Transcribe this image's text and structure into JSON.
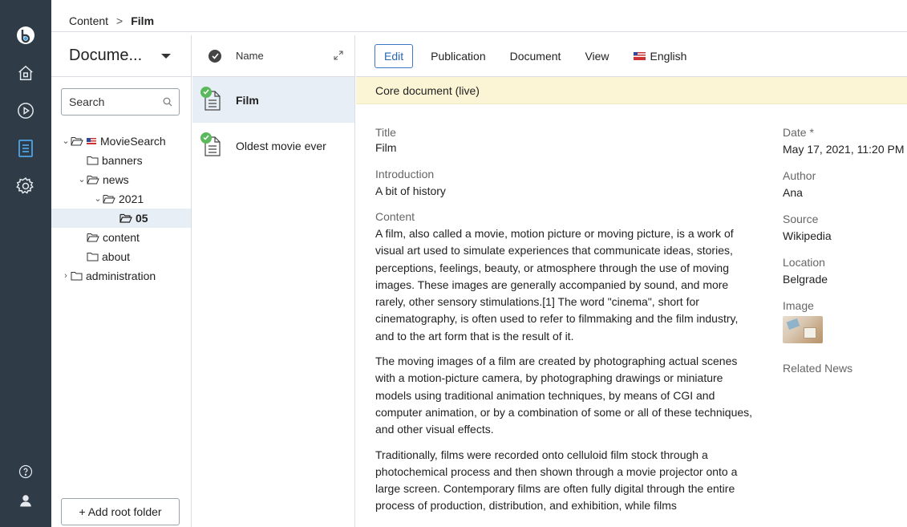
{
  "breadcrumb": {
    "root": "Content",
    "separator": ">",
    "current": "Film"
  },
  "tree_panel": {
    "title": "Docume...",
    "search_placeholder": "Search",
    "items": [
      {
        "label": "MovieSearch",
        "expanded": true,
        "flag": true
      },
      {
        "label": "banners"
      },
      {
        "label": "news",
        "expanded": true
      },
      {
        "label": "2021",
        "expanded": true
      },
      {
        "label": "05",
        "selected": true
      },
      {
        "label": "content"
      },
      {
        "label": "about"
      },
      {
        "label": "administration",
        "expanded": false
      }
    ],
    "add_root": "+ Add root folder"
  },
  "list_panel": {
    "column": "Name",
    "items": [
      {
        "name": "Film",
        "selected": true
      },
      {
        "name": "Oldest movie ever"
      }
    ]
  },
  "tabs": [
    "Edit",
    "Publication",
    "Document",
    "View",
    "English"
  ],
  "banner": "Core document (live)",
  "fields": {
    "title_label": "Title",
    "title": "Film",
    "intro_label": "Introduction",
    "intro": "A bit of history",
    "content_label": "Content",
    "paragraphs": [
      "A film, also called a movie, motion picture or moving picture, is a work of visual art used to simulate experiences that communicate ideas, stories, perceptions, feelings, beauty, or atmosphere through the use of moving images. These images are generally accompanied by sound, and more rarely, other sensory stimulations.[1] The word \"cinema\", short for cinematography, is often used to refer to filmmaking and the film industry, and to the art form that is the result of it.",
      "The moving images of a film are created by photographing actual scenes with a motion-picture camera, by photographing drawings or miniature models using traditional animation techniques, by means of CGI and computer animation, or by a combination of some or all of these techniques, and other visual effects.",
      "Traditionally, films were recorded onto celluloid film stock through a photochemical process and then shown through a movie projector onto a large screen. Contemporary films are often fully digital through the entire process of production, distribution, and exhibition, while films"
    ]
  },
  "side": {
    "date_label": "Date *",
    "date": "May 17, 2021, 11:20 PM",
    "author_label": "Author",
    "author": "Ana",
    "source_label": "Source",
    "source": "Wikipedia",
    "location_label": "Location",
    "location": "Belgrade",
    "image_label": "Image",
    "related_label": "Related News"
  },
  "colors": {
    "rail": "#2f3b47",
    "accent": "#3b79c8",
    "banner": "#fbf5d6",
    "selection": "#e8eef6",
    "status": "#5cb85c"
  }
}
